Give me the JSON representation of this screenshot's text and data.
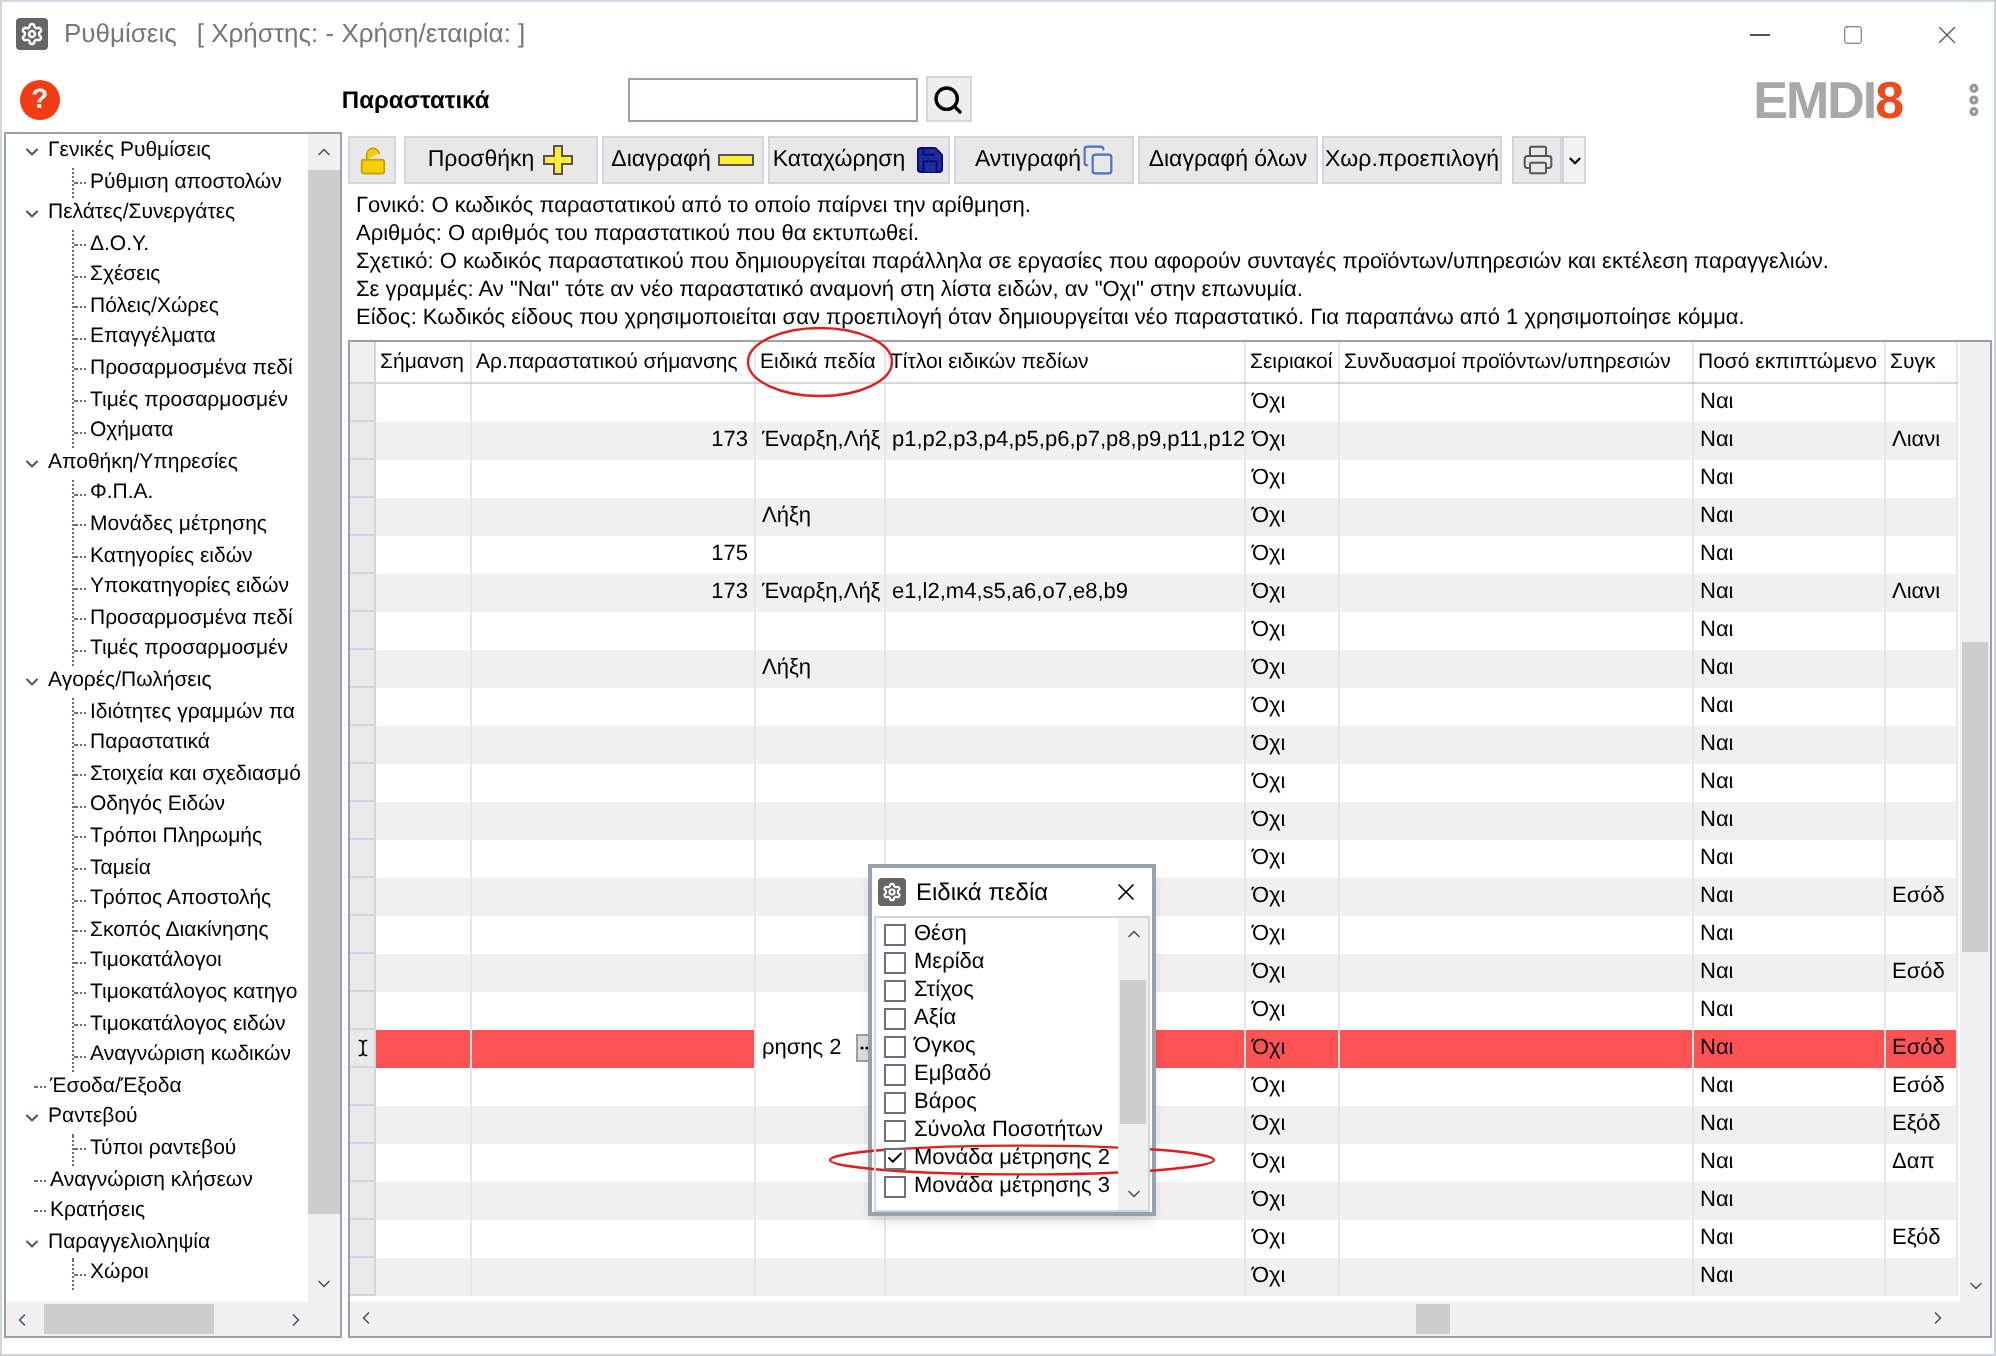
{
  "window": {
    "title": "Ρυθμίσεις",
    "subtitle": "[ Χρήστης: - Χρήση/εταιρία: ]"
  },
  "help_button": "?",
  "section_title": "Παραστατικά",
  "logo": {
    "text": "EMDI",
    "accent": "8"
  },
  "tree": [
    {
      "label": "Γενικές Ρυθμίσεις",
      "expanded": true,
      "children": [
        {
          "label": "Ρύθμιση αποστολών"
        }
      ]
    },
    {
      "label": "Πελάτες/Συνεργάτες",
      "expanded": true,
      "children": [
        {
          "label": "Δ.Ο.Υ."
        },
        {
          "label": "Σχέσεις"
        },
        {
          "label": "Πόλεις/Χώρες"
        },
        {
          "label": "Επαγγέλματα"
        },
        {
          "label": "Προσαρμοσμένα πεδί"
        },
        {
          "label": "Τιμές προσαρμοσμέν"
        },
        {
          "label": "Οχήματα"
        }
      ]
    },
    {
      "label": "Αποθήκη/Υπηρεσίες",
      "expanded": true,
      "children": [
        {
          "label": "Φ.Π.Α."
        },
        {
          "label": "Μονάδες μέτρησης"
        },
        {
          "label": "Κατηγορίες ειδών"
        },
        {
          "label": "Υποκατηγορίες ειδών"
        },
        {
          "label": "Προσαρμοσμένα πεδί"
        },
        {
          "label": "Τιμές προσαρμοσμέν"
        }
      ]
    },
    {
      "label": "Αγορές/Πωλήσεις",
      "expanded": true,
      "children": [
        {
          "label": "Ιδιότητες γραμμών πα"
        },
        {
          "label": "Παραστατικά"
        },
        {
          "label": "Στοιχεία και σχεδιασμό"
        },
        {
          "label": "Οδηγός Ειδών"
        },
        {
          "label": "Τρόποι Πληρωμής"
        },
        {
          "label": "Ταμεία"
        },
        {
          "label": "Τρόπος Αποστολής"
        },
        {
          "label": "Σκοπός Διακίνησης"
        },
        {
          "label": "Τιμοκατάλογοι"
        },
        {
          "label": "Τιμοκατάλογος κατηγο"
        },
        {
          "label": "Τιμοκατάλογος ειδών"
        },
        {
          "label": "Αναγνώριση κωδικών"
        }
      ]
    },
    {
      "label": "Έσοδα/Έξοδα",
      "expanded": false
    },
    {
      "label": "Ραντεβού",
      "expanded": true,
      "children": [
        {
          "label": "Τύποι ραντεβού"
        }
      ]
    },
    {
      "label": "Αναγνώριση κλήσεων",
      "expanded": false
    },
    {
      "label": "Κρατήσεις",
      "expanded": false
    },
    {
      "label": "Παραγγελιοληψία",
      "expanded": true,
      "children": [
        {
          "label": "Χώροι"
        }
      ]
    }
  ],
  "toolbar": [
    {
      "kind": "lock"
    },
    {
      "kind": "add",
      "label": "Προσθήκη"
    },
    {
      "kind": "delete",
      "label": "Διαγραφή"
    },
    {
      "kind": "save",
      "label": "Καταχώρηση"
    },
    {
      "kind": "copy",
      "label": "Αντιγραφή"
    },
    {
      "kind": "text",
      "label": "Διαγραφή όλων"
    },
    {
      "kind": "text",
      "label": "Χωρ.προεπιλογή"
    },
    {
      "kind": "print"
    }
  ],
  "info_lines": [
    "Γονικό: Ο κωδικός παραστατικού από το οποίο παίρνει την αρίθμηση.",
    "Αριθμός: Ο αριθμός του παραστατικού που θα εκτυπωθεί.",
    "Σχετικό: Ο κωδικός παραστατικού που δημιουργείται παράλληλα σε εργασίες που αφορούν συνταγές προϊόντων/υπηρεσιών και εκτέλεση παραγγελιών.",
    "Σε γραμμές: Αν \"Ναι\" τότε αν νέο παραστατικό αναμονή στη λίστα ειδών, αν \"Οχι\" στην επωνυμία.",
    "Είδος: Κωδικός είδους που χρησιμοποιείται σαν προεπιλογή όταν δημιουργείται νέο παραστατικό. Για παραπάνω από 1 χρησιμοποίησε κόμμα."
  ],
  "table": {
    "columns": [
      "Σήμανση",
      "Αρ.παραστατικού σήμανσης",
      "Ειδικά πεδία",
      "Τίτλοι ειδικών πεδίων",
      "Σειριακοί",
      "Συνδυασμοί προϊόντων/υπηρεσιών",
      "Ποσό εκπιπτώμενο",
      "Συγκ"
    ],
    "rows": [
      {
        "selected": false,
        "serials": "Όχι",
        "deductible": "Ναι"
      },
      {
        "selected": false,
        "sign_number": "173",
        "special_fields": "Έναρξη,Λήξ",
        "field_titles": "p1,p2,p3,p4,p5,p6,p7,p8,p9,p11,p12",
        "serials": "Όχι",
        "deductible": "Ναι",
        "column_8": "Λιανι"
      },
      {
        "selected": false,
        "serials": "Όχι",
        "deductible": "Ναι"
      },
      {
        "selected": false,
        "special_fields": "Λήξη",
        "serials": "Όχι",
        "deductible": "Ναι"
      },
      {
        "selected": false,
        "sign_number": "175",
        "serials": "Όχι",
        "deductible": "Ναι"
      },
      {
        "selected": false,
        "sign_number": "173",
        "special_fields": "Έναρξη,Λήξ",
        "field_titles": "e1,l2,m4,s5,a6,o7,e8,b9",
        "serials": "Όχι",
        "deductible": "Ναι",
        "column_8": "Λιανι"
      },
      {
        "selected": false,
        "serials": "Όχι",
        "deductible": "Ναι"
      },
      {
        "selected": false,
        "special_fields": "Λήξη",
        "serials": "Όχι",
        "deductible": "Ναι"
      },
      {
        "selected": false,
        "serials": "Όχι",
        "deductible": "Ναι"
      },
      {
        "selected": false,
        "serials": "Όχι",
        "deductible": "Ναι"
      },
      {
        "selected": false,
        "serials": "Όχι",
        "deductible": "Ναι"
      },
      {
        "selected": false,
        "serials": "Όχι",
        "deductible": "Ναι"
      },
      {
        "selected": false,
        "serials": "Όχι",
        "deductible": "Ναι"
      },
      {
        "selected": false,
        "serials": "Όχι",
        "deductible": "Ναι",
        "column_8": "Εσόδ"
      },
      {
        "selected": false,
        "serials": "Όχι",
        "deductible": "Ναι"
      },
      {
        "selected": false,
        "serials": "Όχι",
        "deductible": "Ναι",
        "column_8": "Εσόδ"
      },
      {
        "selected": false,
        "serials": "Όχι",
        "deductible": "Ναι"
      },
      {
        "selected": true,
        "special_fields": "ρησης 2",
        "serials": "Όχι",
        "deductible": "Ναι",
        "column_8": "Εσόδ"
      },
      {
        "selected": false,
        "serials": "Όχι",
        "deductible": "Ναι",
        "column_8": "Εσόδ"
      },
      {
        "selected": false,
        "serials": "Όχι",
        "deductible": "Ναι",
        "column_8": "Εξόδ"
      },
      {
        "selected": false,
        "serials": "Όχι",
        "deductible": "Ναι",
        "column_8": "Δαπ"
      },
      {
        "selected": false,
        "serials": "Όχι",
        "deductible": "Ναι"
      },
      {
        "selected": false,
        "serials": "Όχι",
        "deductible": "Ναι",
        "column_8": "Εξόδ"
      },
      {
        "selected": false,
        "serials": "Όχι",
        "deductible": "Ναι"
      }
    ]
  },
  "popup": {
    "title": "Ειδικά πεδία",
    "items": [
      {
        "label": "Θέση",
        "checked": false
      },
      {
        "label": "Μερίδα",
        "checked": false
      },
      {
        "label": "Στίχος",
        "checked": false
      },
      {
        "label": "Αξία",
        "checked": false
      },
      {
        "label": "Όγκος",
        "checked": false
      },
      {
        "label": "Εμβαδό",
        "checked": false
      },
      {
        "label": "Βάρος",
        "checked": false
      },
      {
        "label": "Σύνολα Ποσοτήτων",
        "checked": false
      },
      {
        "label": "Μονάδα μέτρησης 2",
        "checked": true
      },
      {
        "label": "Μονάδα μέτρησης 3",
        "checked": false
      }
    ]
  }
}
